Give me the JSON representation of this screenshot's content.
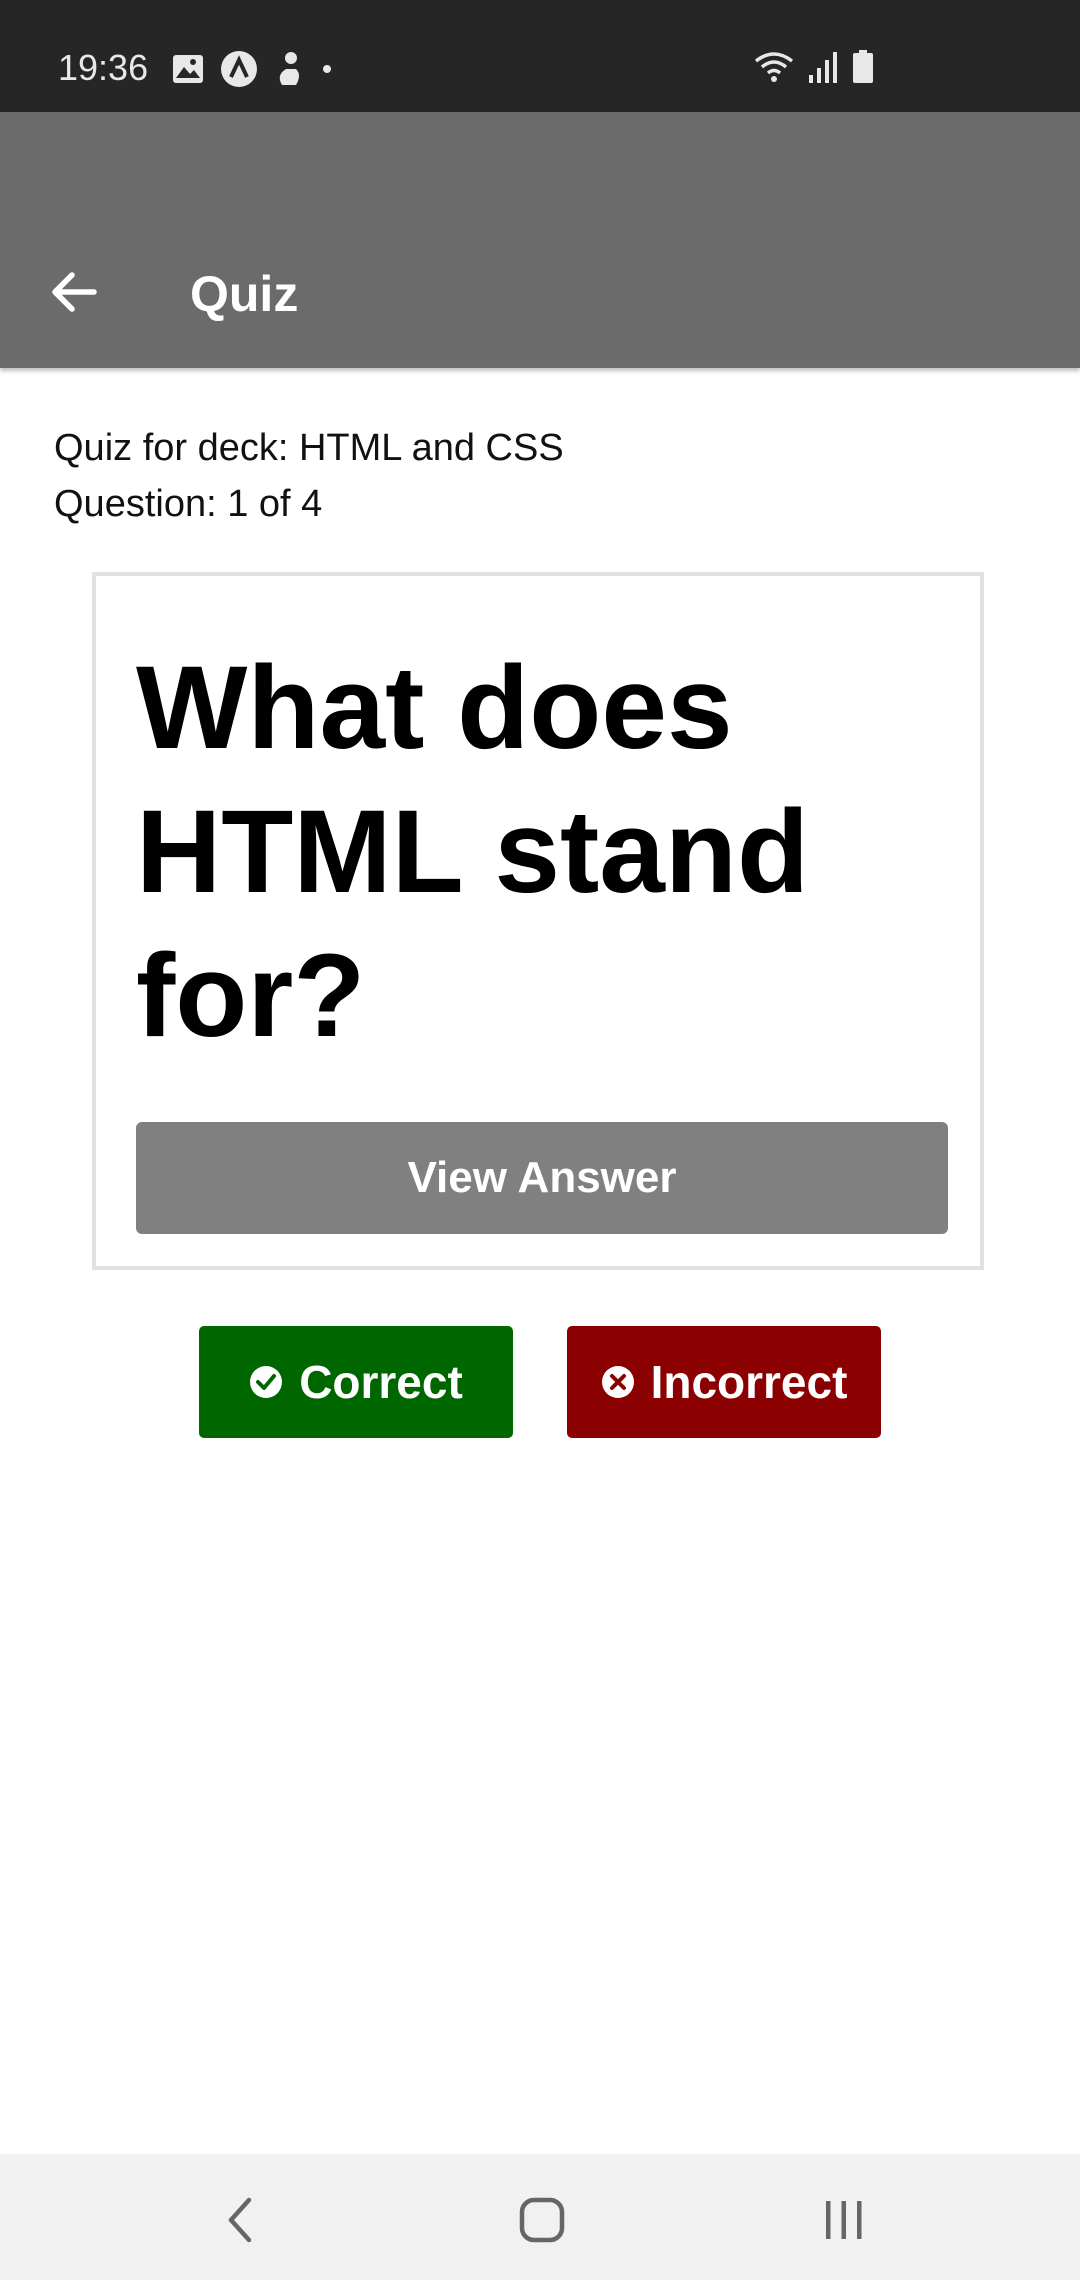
{
  "status_bar": {
    "time": "19:36",
    "left_icons": [
      "gallery-icon",
      "app-notification-icon",
      "person-icon",
      "dot-icon"
    ],
    "right_icons": [
      "wifi-icon",
      "signal-icon",
      "battery-icon"
    ]
  },
  "app_bar": {
    "title": "Quiz",
    "back_icon": "arrow-left-icon",
    "color": "#6b6b6b"
  },
  "quiz": {
    "deck_line": "Quiz for deck: HTML and CSS",
    "progress_line": "Question: 1 of 4"
  },
  "card": {
    "question": "What does HTML stand for?",
    "view_answer_label": "View Answer"
  },
  "actions": {
    "correct_label": "Correct",
    "correct_color": "#006600",
    "correct_icon": "check-circle-icon",
    "incorrect_label": "Incorrect",
    "incorrect_color": "#8b0000",
    "incorrect_icon": "x-circle-icon"
  },
  "nav_bar": {
    "buttons": [
      "back-nav-icon",
      "home-nav-icon",
      "recents-nav-icon"
    ]
  }
}
